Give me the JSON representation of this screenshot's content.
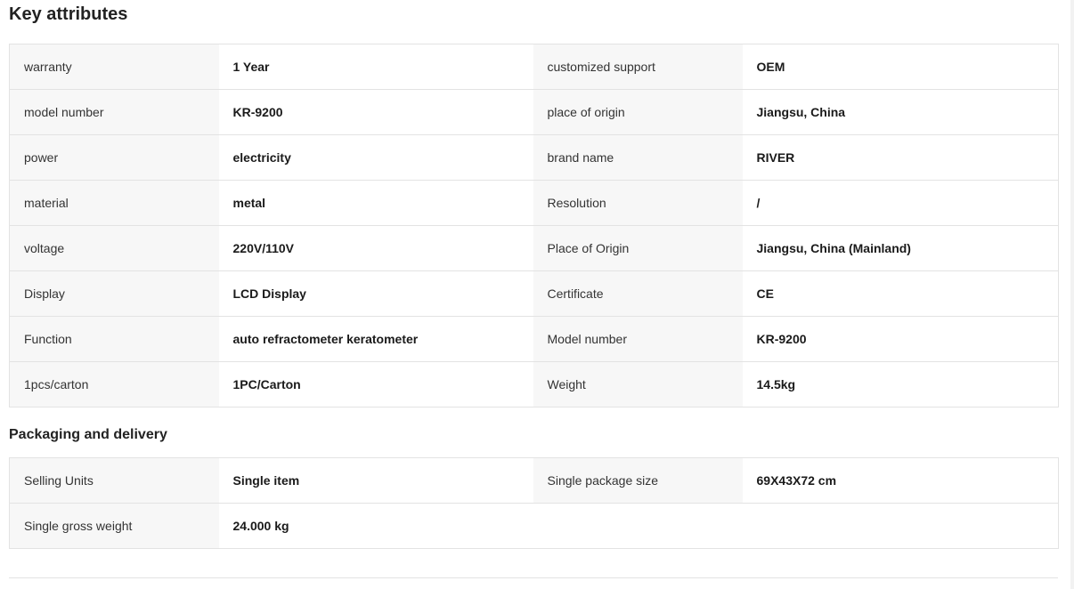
{
  "key_attributes": {
    "title": "Key attributes",
    "rows": [
      {
        "l1": "warranty",
        "v1": "1 Year",
        "l2": "customized support",
        "v2": "OEM"
      },
      {
        "l1": "model number",
        "v1": "KR-9200",
        "l2": "place of origin",
        "v2": "Jiangsu, China"
      },
      {
        "l1": "power",
        "v1": "electricity",
        "l2": "brand name",
        "v2": "RIVER"
      },
      {
        "l1": "material",
        "v1": "metal",
        "l2": "Resolution",
        "v2": "/"
      },
      {
        "l1": "voltage",
        "v1": "220V/110V",
        "l2": "Place of Origin",
        "v2": "Jiangsu, China (Mainland)"
      },
      {
        "l1": "Display",
        "v1": "LCD Display",
        "l2": "Certificate",
        "v2": "CE"
      },
      {
        "l1": "Function",
        "v1": "auto refractometer keratometer",
        "l2": "Model number",
        "v2": "KR-9200"
      },
      {
        "l1": "1pcs/carton",
        "v1": "1PC/Carton",
        "l2": "Weight",
        "v2": "14.5kg"
      }
    ]
  },
  "packaging": {
    "title": "Packaging and delivery",
    "rows": [
      {
        "l1": "Selling Units",
        "v1": "Single item",
        "l2": "Single package size",
        "v2": "69X43X72 cm"
      },
      {
        "l1": "Single gross weight",
        "v1": "24.000 kg"
      }
    ]
  }
}
